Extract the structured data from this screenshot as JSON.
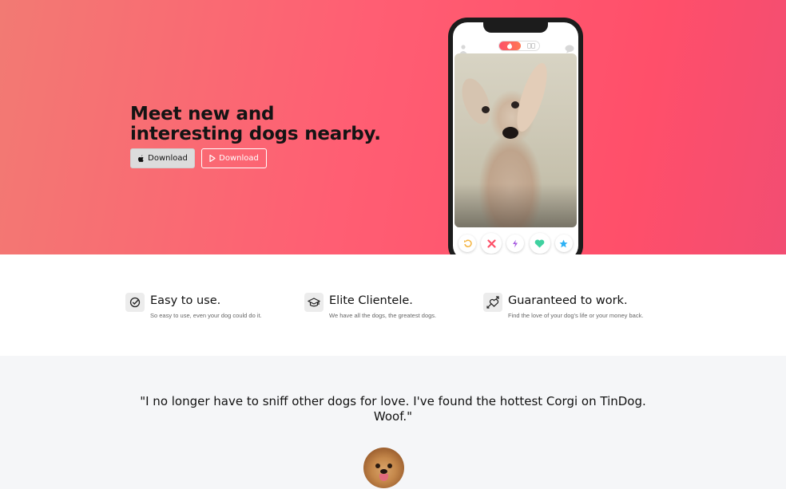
{
  "hero": {
    "title": "Meet new and interesting dogs nearby.",
    "buttons": [
      {
        "label": "Download",
        "icon": "apple-icon"
      },
      {
        "label": "Download",
        "icon": "play-icon"
      }
    ],
    "gradient_colors": [
      "#f27a73",
      "#ff4f6a"
    ]
  },
  "phone": {
    "top_icons": [
      "user-icon",
      "flame-toggle",
      "chat-icon"
    ],
    "actions": [
      "rewind-icon",
      "nope-icon",
      "boost-icon",
      "like-icon",
      "superlike-icon"
    ]
  },
  "features": [
    {
      "icon": "check-circle-icon",
      "title": "Easy to use.",
      "desc": "So easy to use, even your dog could do it."
    },
    {
      "icon": "graduation-cap-icon",
      "title": "Elite Clientele.",
      "desc": "We have all the dogs, the greatest dogs."
    },
    {
      "icon": "heart-arrow-icon",
      "title": "Guaranteed to work.",
      "desc": "Find the love of your dog's life or your money back."
    }
  ],
  "testimonial": {
    "quote": "\"I no longer have to sniff other dogs for love. I've found the hottest Corgi on TinDog. Woof.\""
  }
}
